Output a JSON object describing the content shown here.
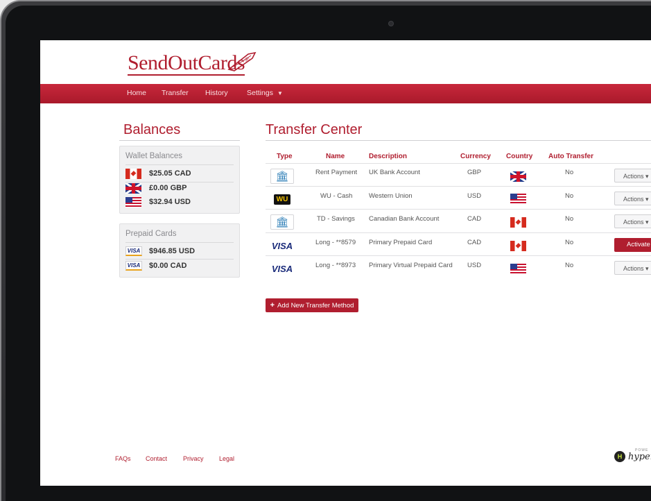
{
  "brand": {
    "name": "SendOutCards",
    "registered": "®"
  },
  "nav": {
    "items": [
      "Home",
      "Transfer",
      "History",
      "Settings"
    ],
    "settings_caret": "▼"
  },
  "balances": {
    "title": "Balances",
    "wallet": {
      "title": "Wallet Balances",
      "rows": [
        {
          "flag": "flag-ca",
          "value": "$25.05 CAD"
        },
        {
          "flag": "flag-uk",
          "value": "£0.00 GBP"
        },
        {
          "flag": "flag-us",
          "value": "$32.94 USD"
        }
      ]
    },
    "prepaid": {
      "title": "Prepaid Cards",
      "rows": [
        {
          "icon": "visa-card-icon",
          "label": "VISA",
          "value": "$946.85 USD"
        },
        {
          "icon": "visa-card-icon",
          "label": "VISA",
          "value": "$0.00 CAD"
        }
      ]
    }
  },
  "transfer": {
    "title": "Transfer Center",
    "columns": [
      "Type",
      "Name",
      "Description",
      "Currency",
      "Country",
      "Auto Transfer"
    ],
    "rows": [
      {
        "type": "bank-icon",
        "type_label": "🏛",
        "name": "Rent Payment",
        "description": "UK Bank Account",
        "currency": "GBP",
        "country": "flag-uk",
        "auto": "No",
        "action": "Actions"
      },
      {
        "type": "western-union-icon",
        "type_label": "WU",
        "name": "WU - Cash",
        "description": "Western Union",
        "currency": "USD",
        "country": "flag-us",
        "auto": "No",
        "action": "Actions"
      },
      {
        "type": "bank-icon",
        "type_label": "🏛",
        "name": "TD - Savings",
        "description": "Canadian Bank Account",
        "currency": "CAD",
        "country": "flag-ca",
        "auto": "No",
        "action": "Actions"
      },
      {
        "type": "visa-card-icon",
        "type_label": "VISA",
        "name": "Long - **8579",
        "description": "Primary Prepaid Card",
        "currency": "CAD",
        "country": "flag-ca",
        "auto": "No",
        "action": "Activate"
      },
      {
        "type": "visa-card-icon",
        "type_label": "VISA",
        "name": "Long - **8973",
        "description": "Primary Virtual Prepaid Card",
        "currency": "USD",
        "country": "flag-us",
        "auto": "No",
        "action": "Actions"
      }
    ],
    "actions_caret": "▾",
    "add_button": {
      "plus": "+",
      "label": "Add New Transfer Method"
    }
  },
  "footer": {
    "links": [
      "FAQs",
      "Contact",
      "Privacy",
      "Legal"
    ]
  },
  "powered": {
    "small": "POWE",
    "name": "hyper",
    "badge": "H"
  },
  "colors": {
    "brand_red": "#b01e2f",
    "nav_red": "#c8283b",
    "bank_blue": "#2f7fb7",
    "wu_yellow": "#f7c400"
  }
}
